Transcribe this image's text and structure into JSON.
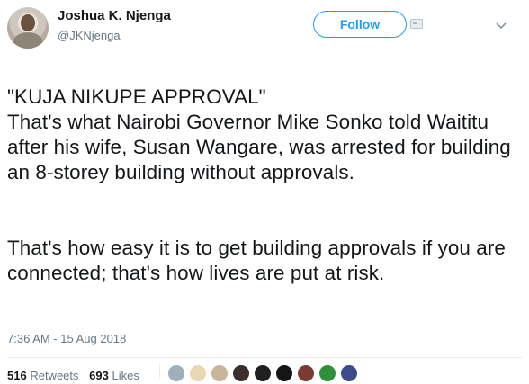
{
  "author": {
    "name": "Joshua K. Njenga",
    "handle": "@JKNjenga"
  },
  "follow_button": {
    "label": "Follow",
    "color": "#1da1f2"
  },
  "tweet": {
    "paragraphs": [
      "\"KUJA NIKUPE APPROVAL\"\nThat's what Nairobi Governor Mike Sonko told Waititu after his wife, Susan Wangare, was arrested for building an 8-storey building without approvals.",
      "That's how easy it is to get building approvals if you are connected; that's how lives are put at risk."
    ],
    "timestamp": "7:36 AM - 15 Aug 2018"
  },
  "stats": {
    "retweets_count": "516",
    "retweets_label": "Retweets",
    "likes_count": "693",
    "likes_label": "Likes"
  },
  "liker_avatar_colors": [
    "#9fb0bd",
    "#e7d8b0",
    "#c8b59a",
    "#3a2f2a",
    "#1f1f1f",
    "#151515",
    "#7a3b32",
    "#2f8f3a",
    "#3d4b8a"
  ],
  "icons": {
    "card": "card-icon",
    "caret": "chevron-down-icon"
  }
}
